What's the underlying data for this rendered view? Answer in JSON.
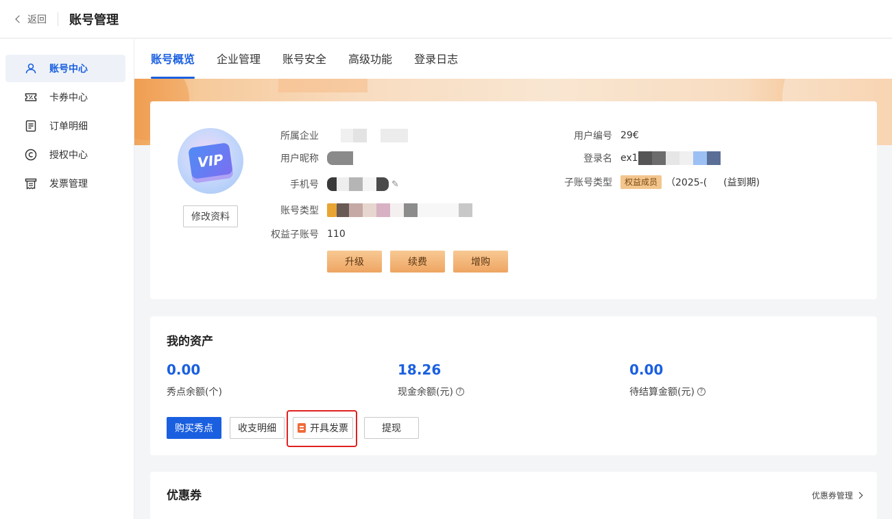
{
  "header": {
    "back_label": "返回",
    "title": "账号管理"
  },
  "sidebar": {
    "items": [
      {
        "label": "账号中心",
        "icon": "user-icon",
        "active": true
      },
      {
        "label": "卡券中心",
        "icon": "coupon-icon",
        "active": false
      },
      {
        "label": "订单明细",
        "icon": "order-list-icon",
        "active": false
      },
      {
        "label": "授权中心",
        "icon": "copyright-icon",
        "active": false
      },
      {
        "label": "发票管理",
        "icon": "invoice-icon",
        "active": false
      }
    ]
  },
  "tabs": [
    {
      "label": "账号概览",
      "active": true
    },
    {
      "label": "企业管理",
      "active": false
    },
    {
      "label": "账号安全",
      "active": false
    },
    {
      "label": "高级功能",
      "active": false
    },
    {
      "label": "登录日志",
      "active": false
    }
  ],
  "profile": {
    "avatar_text": "VIP",
    "edit_button": "修改资料",
    "fields_left": [
      {
        "label": "所属企业",
        "value": ""
      },
      {
        "label": "用户昵称",
        "value": ""
      },
      {
        "label": "手机号",
        "value": ""
      },
      {
        "label": "账号类型",
        "value": ""
      },
      {
        "label": "权益子账号",
        "value": "110"
      }
    ],
    "fields_right": [
      {
        "label": "用户编号",
        "value": "29€"
      },
      {
        "label": "登录名",
        "value": "ex1"
      },
      {
        "label": "子账号类型",
        "badge": "权益成员",
        "value_prefix": "（2025-(",
        "value_suffix": "(益到期)"
      }
    ],
    "buttons": {
      "upgrade": "升级",
      "renew": "续费",
      "add": "增购"
    }
  },
  "assets": {
    "title": "我的资产",
    "items": [
      {
        "value": "0.00",
        "label": "秀点余额(个)",
        "has_help": false
      },
      {
        "value": "18.26",
        "label": "现金余额(元)",
        "has_help": true
      },
      {
        "value": "0.00",
        "label": "待结算金额(元)",
        "has_help": true
      }
    ],
    "help_glyph": "?",
    "buttons": {
      "buy": "购买秀点",
      "details": "收支明细",
      "invoice": "开具发票",
      "withdraw": "提现"
    }
  },
  "coupons": {
    "title": "优惠券",
    "manage_link": "优惠券管理"
  },
  "colors": {
    "accent": "#1a5fe0",
    "gold": "#eea562",
    "highlight": "#e02020"
  }
}
